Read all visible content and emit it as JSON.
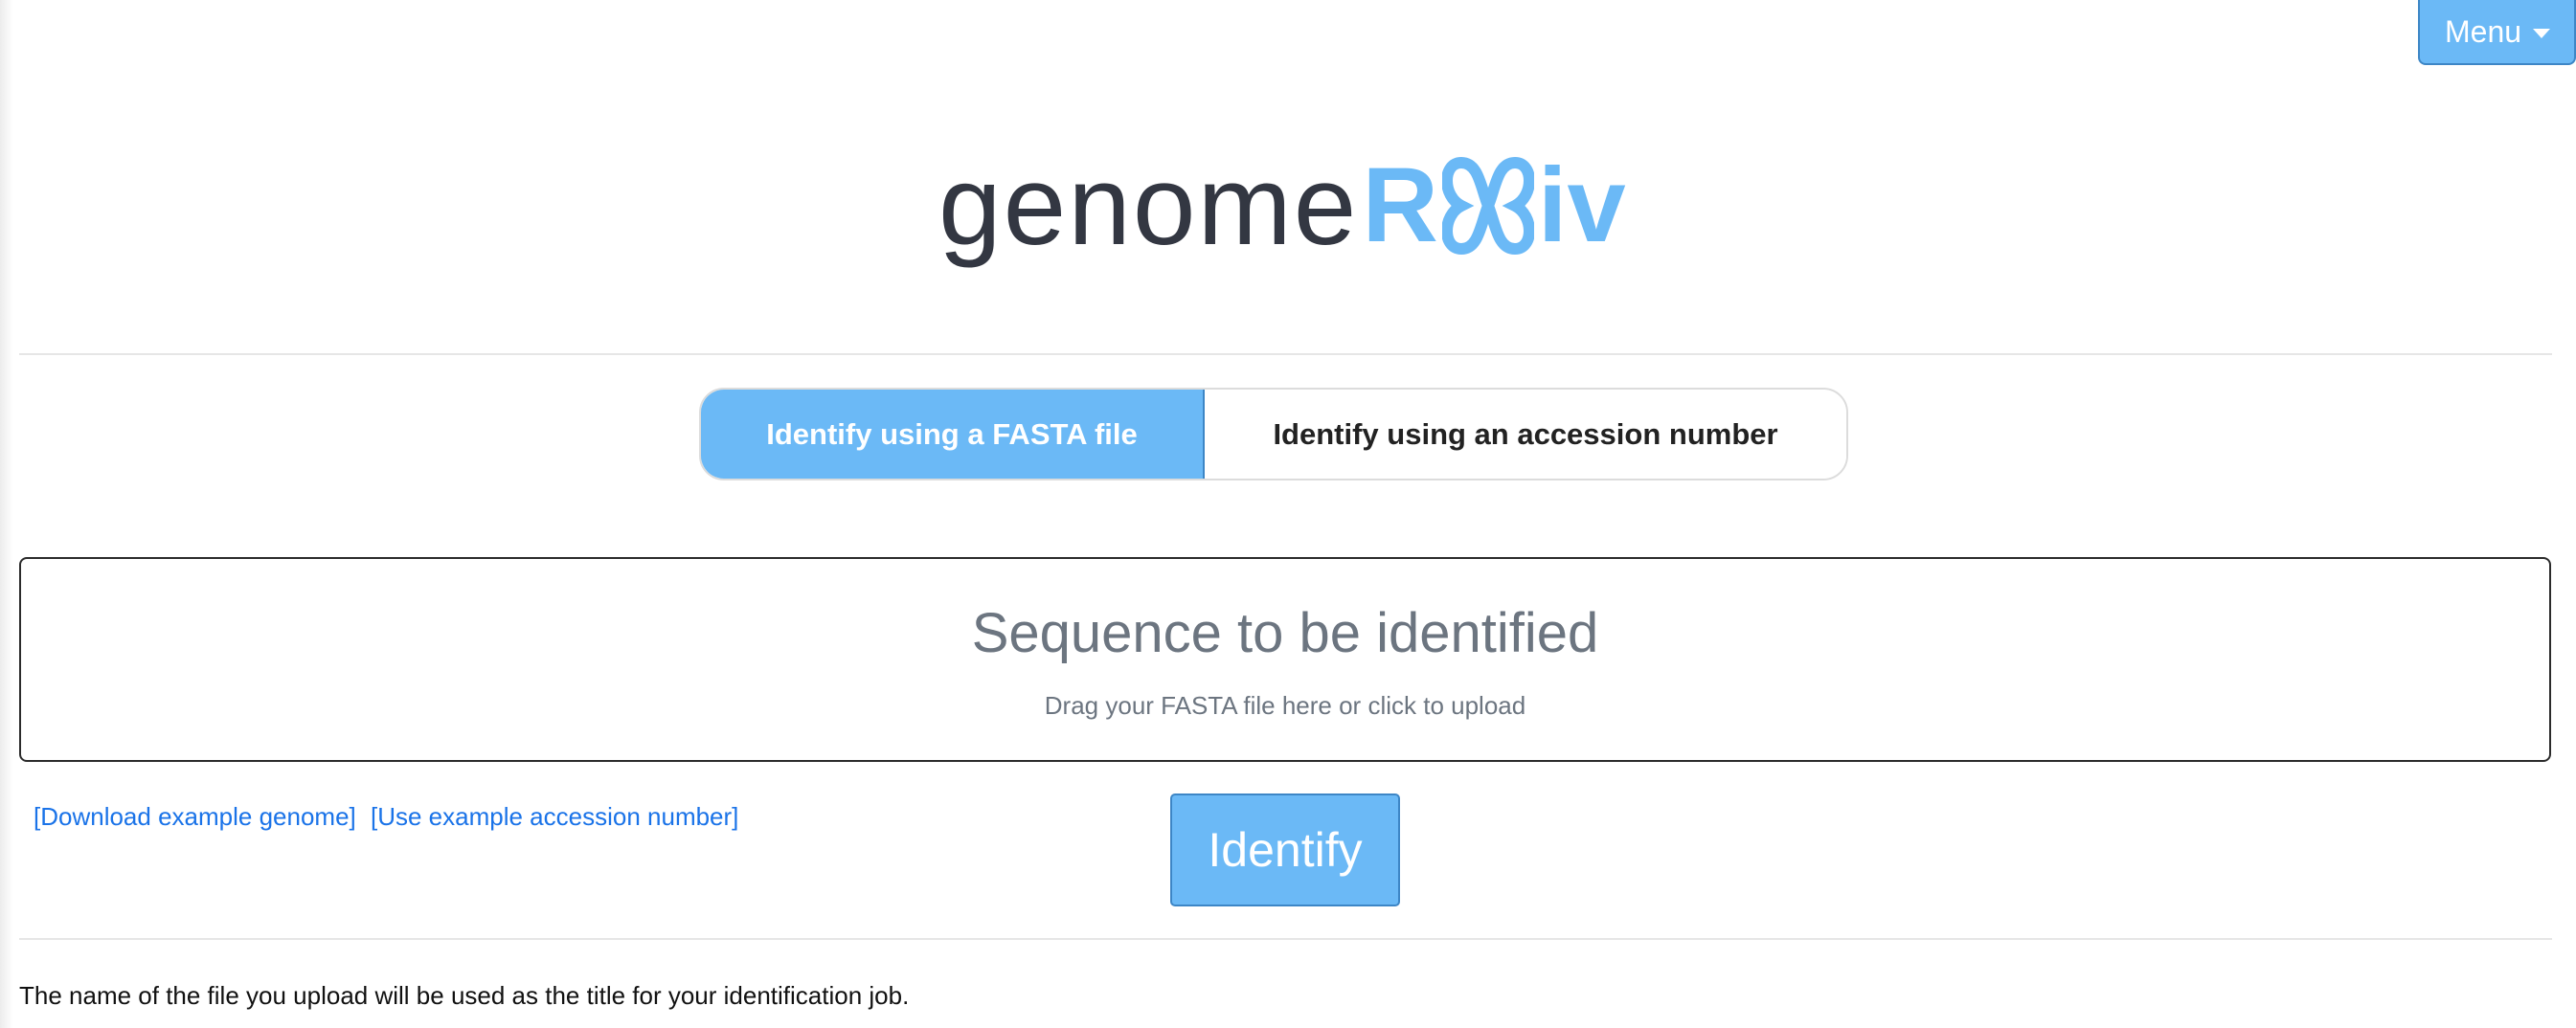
{
  "header": {
    "menu_label": "Menu",
    "menu_icon": "caret-down-icon"
  },
  "logo": {
    "part1": "genome",
    "part2": "R",
    "part3": "iv",
    "mark_icon": "chromosome-icon",
    "accent_color": "#6bb9f6",
    "dark_color": "#333742"
  },
  "tabs": [
    {
      "label": "Identify using a FASTA file",
      "active": true
    },
    {
      "label": "Identify using an accession number",
      "active": false
    }
  ],
  "upload": {
    "title": "Sequence to be identified",
    "subtitle": "Drag your FASTA file here or click to upload"
  },
  "links": {
    "download_example": "[Download example genome]",
    "use_accession": "[Use example accession number]"
  },
  "actions": {
    "identify_label": "Identify"
  },
  "footer": {
    "note": "The name of the file you upload will be used as the title for your identification job."
  },
  "colors": {
    "primary": "#6bb9f6",
    "primary_border": "#3d86c6",
    "link": "#1a73e8",
    "muted_text": "#6c7580"
  }
}
